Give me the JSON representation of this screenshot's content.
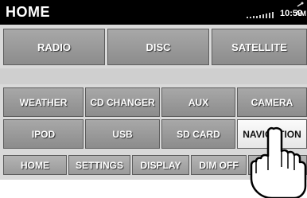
{
  "header": {
    "title": "HOME",
    "time": "10:59",
    "ampm": "AM"
  },
  "grid": {
    "row1": [
      "RADIO",
      "DISC",
      "SATELLITE"
    ],
    "row2": [
      "WEATHER",
      "CD CHANGER",
      "AUX",
      "CAMERA"
    ],
    "row3": [
      "IPOD",
      "USB",
      "SD CARD",
      "NAVIGATION"
    ]
  },
  "bottom_nav": [
    "HOME",
    "SETTINGS",
    "DISPLAY",
    "DIM OFF"
  ],
  "colors": {
    "button": "#999999",
    "selected": "#f2f2f2",
    "status_bar": "#000000"
  },
  "icons": [
    "signal-strength-icon",
    "satellite-icon",
    "pointing-hand-icon"
  ]
}
